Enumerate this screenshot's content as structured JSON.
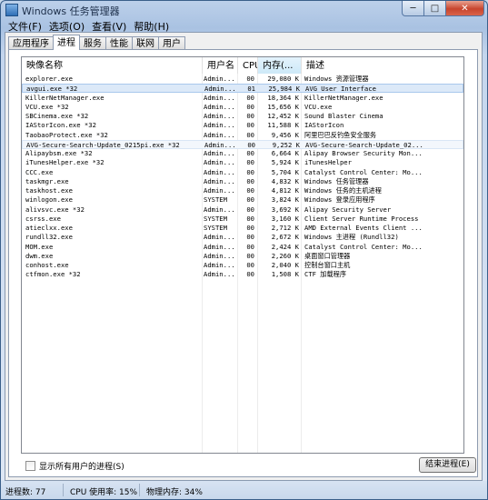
{
  "window": {
    "title": "Windows 任务管理器"
  },
  "caption_buttons": {
    "minimize": "─",
    "maximize": "□",
    "close": "✕"
  },
  "menu": [
    "文件(F)",
    "选项(O)",
    "查看(V)",
    "帮助(H)"
  ],
  "tabs": [
    {
      "label": "应用程序",
      "active": false
    },
    {
      "label": "进程",
      "active": true
    },
    {
      "label": "服务",
      "active": false
    },
    {
      "label": "性能",
      "active": false
    },
    {
      "label": "联网",
      "active": false
    },
    {
      "label": "用户",
      "active": false
    }
  ],
  "columns": {
    "name": "映像名称",
    "user": "用户名",
    "cpu": "CPU",
    "mem": "内存(...",
    "desc": "描述"
  },
  "processes": [
    {
      "name": "explorer.exe",
      "user": "Admin...",
      "cpu": "00",
      "mem": "29,080 K",
      "desc": "Windows 资源管理器"
    },
    {
      "name": "avgui.exe *32",
      "user": "Admin...",
      "cpu": "01",
      "mem": "25,984 K",
      "desc": "AVG User Interface"
    },
    {
      "name": "KillerNetManager.exe",
      "user": "Admin...",
      "cpu": "00",
      "mem": "18,364 K",
      "desc": "KillerNetManager.exe"
    },
    {
      "name": "VCU.exe *32",
      "user": "Admin...",
      "cpu": "00",
      "mem": "15,656 K",
      "desc": "VCU.exe"
    },
    {
      "name": "SBCinema.exe *32",
      "user": "Admin...",
      "cpu": "00",
      "mem": "12,452 K",
      "desc": "Sound Blaster Cinema"
    },
    {
      "name": "IAStorIcon.exe *32",
      "user": "Admin...",
      "cpu": "00",
      "mem": "11,588 K",
      "desc": "IAStorIcon"
    },
    {
      "name": "TaobaoProtect.exe *32",
      "user": "Admin...",
      "cpu": "00",
      "mem": "9,456 K",
      "desc": "阿里巴巴反钓鱼安全服务"
    },
    {
      "name": "AVG-Secure-Search-Update_0215pi.exe *32",
      "user": "Admin...",
      "cpu": "00",
      "mem": "9,252 K",
      "desc": "AVG-Secure-Search-Update_02..."
    },
    {
      "name": "Alipaybsm.exe *32",
      "user": "Admin...",
      "cpu": "00",
      "mem": "6,664 K",
      "desc": "Alipay Browser Security Mon..."
    },
    {
      "name": "iTunesHelper.exe *32",
      "user": "Admin...",
      "cpu": "00",
      "mem": "5,924 K",
      "desc": "iTunesHelper"
    },
    {
      "name": "CCC.exe",
      "user": "Admin...",
      "cpu": "00",
      "mem": "5,704 K",
      "desc": "Catalyst Control Center: Mo..."
    },
    {
      "name": "taskmgr.exe",
      "user": "Admin...",
      "cpu": "00",
      "mem": "4,832 K",
      "desc": "Windows 任务管理器"
    },
    {
      "name": "taskhost.exe",
      "user": "Admin...",
      "cpu": "00",
      "mem": "4,812 K",
      "desc": "Windows 任务的主机进程"
    },
    {
      "name": "winlogon.exe",
      "user": "SYSTEM",
      "cpu": "00",
      "mem": "3,824 K",
      "desc": "Windows 登录应用程序"
    },
    {
      "name": "alivsvc.exe *32",
      "user": "Admin...",
      "cpu": "00",
      "mem": "3,692 K",
      "desc": "Alipay Security Server"
    },
    {
      "name": "csrss.exe",
      "user": "SYSTEM",
      "cpu": "00",
      "mem": "3,160 K",
      "desc": "Client Server Runtime Process"
    },
    {
      "name": "atieclxx.exe",
      "user": "SYSTEM",
      "cpu": "00",
      "mem": "2,712 K",
      "desc": "AMD External Events Client ..."
    },
    {
      "name": "rundll32.exe",
      "user": "Admin...",
      "cpu": "00",
      "mem": "2,672 K",
      "desc": "Windows 主进程 (Rundll32)"
    },
    {
      "name": "MOM.exe",
      "user": "Admin...",
      "cpu": "00",
      "mem": "2,424 K",
      "desc": "Catalyst Control Center: Mo..."
    },
    {
      "name": "dwm.exe",
      "user": "Admin...",
      "cpu": "00",
      "mem": "2,260 K",
      "desc": "桌面窗口管理器"
    },
    {
      "name": "conhost.exe",
      "user": "Admin...",
      "cpu": "00",
      "mem": "2,040 K",
      "desc": "控制台窗口主机"
    },
    {
      "name": "ctfmon.exe *32",
      "user": "Admin...",
      "cpu": "00",
      "mem": "1,508 K",
      "desc": "CTF 加载程序"
    }
  ],
  "selected_row": 1,
  "hover_row": 7,
  "show_all_label": "显示所有用户的进程(S)",
  "end_process_label": "结束进程(E)",
  "status": {
    "processes": "进程数: 77",
    "cpu": "CPU 使用率: 15%",
    "memory": "物理内存: 34%"
  }
}
